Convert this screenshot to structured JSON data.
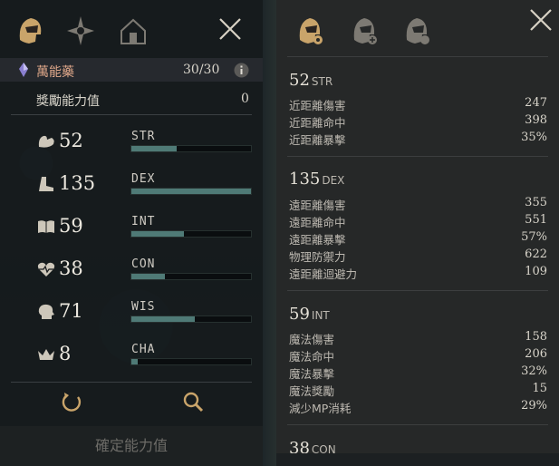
{
  "left_panel": {
    "potion_label": "萬能藥",
    "potion_count": "30/30",
    "bonus_label": "獎勵能力值",
    "bonus_value": "0",
    "stats": [
      {
        "value": "52",
        "name": "STR",
        "fill": 0.38
      },
      {
        "value": "135",
        "name": "DEX",
        "fill": 1.0
      },
      {
        "value": "59",
        "name": "INT",
        "fill": 0.44
      },
      {
        "value": "38",
        "name": "CON",
        "fill": 0.28
      },
      {
        "value": "71",
        "name": "WIS",
        "fill": 0.53
      },
      {
        "value": "8",
        "name": "CHA",
        "fill": 0.05
      }
    ],
    "confirm_label": "確定能力值"
  },
  "right_panel": {
    "sections": [
      {
        "value": "52",
        "name": "STR",
        "rows": [
          {
            "label": "近距離傷害",
            "value": "247"
          },
          {
            "label": "近距離命中",
            "value": "398"
          },
          {
            "label": "近距離暴擊",
            "value": "35%"
          }
        ]
      },
      {
        "value": "135",
        "name": "DEX",
        "rows": [
          {
            "label": "遠距離傷害",
            "value": "355"
          },
          {
            "label": "遠距離命中",
            "value": "551"
          },
          {
            "label": "遠距離暴擊",
            "value": "57%"
          },
          {
            "label": "物理防禦力",
            "value": "622"
          },
          {
            "label": "遠距離迴避力",
            "value": "109"
          }
        ]
      },
      {
        "value": "59",
        "name": "INT",
        "rows": [
          {
            "label": "魔法傷害",
            "value": "158"
          },
          {
            "label": "魔法命中",
            "value": "206"
          },
          {
            "label": "魔法暴擊",
            "value": "32%"
          },
          {
            "label": "魔法獎勵",
            "value": "15"
          },
          {
            "label": "減少MP消耗",
            "value": "29%"
          }
        ]
      },
      {
        "value": "38",
        "name": "CON",
        "rows": []
      }
    ]
  },
  "colors": {
    "accent": "#c9a46a",
    "bar_fill": "#4f7a76"
  }
}
